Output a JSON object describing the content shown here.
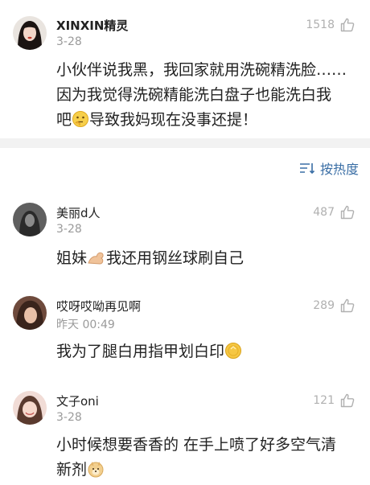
{
  "main_comment": {
    "username": "XINXIN精灵",
    "date": "3-28",
    "likes": "1518",
    "text_line1": "小伙伴说我黑，我回家就用洗碗精洗脸……",
    "text_line2": "因为我觉得洗碗精能洗白盘子也能洗白我",
    "text_line3a": "吧",
    "text_line3b": "导致我妈现在没事还提！"
  },
  "sort": {
    "label": "按热度"
  },
  "replies": [
    {
      "username": "美丽d人",
      "date": "3-28",
      "likes": "487",
      "text_a": "姐妹",
      "text_b": "我还用钢丝球刷自己"
    },
    {
      "username": "哎呀哎呦再见啊",
      "date": "昨天 00:49",
      "likes": "289",
      "text": "我为了腿白用指甲划白印"
    },
    {
      "username": "文子oni",
      "date": "3-28",
      "likes": "121",
      "text_line1": "小时候想要香香的 在手上喷了好多空气清",
      "text_line2": "新剂"
    }
  ],
  "icons": {
    "like": "thumbs-up-outline-icon",
    "sort": "sort-lines-icon",
    "think_emoji": "thinking-face-emoji",
    "arm_emoji": "flexed-biceps-emoji",
    "coin_emoji": "gold-coin-emoji",
    "doge_emoji": "doge-emoji"
  },
  "colors": {
    "accent": "#3a6ea5",
    "muted": "#9a9a9a",
    "band": "#f2f2f2"
  }
}
